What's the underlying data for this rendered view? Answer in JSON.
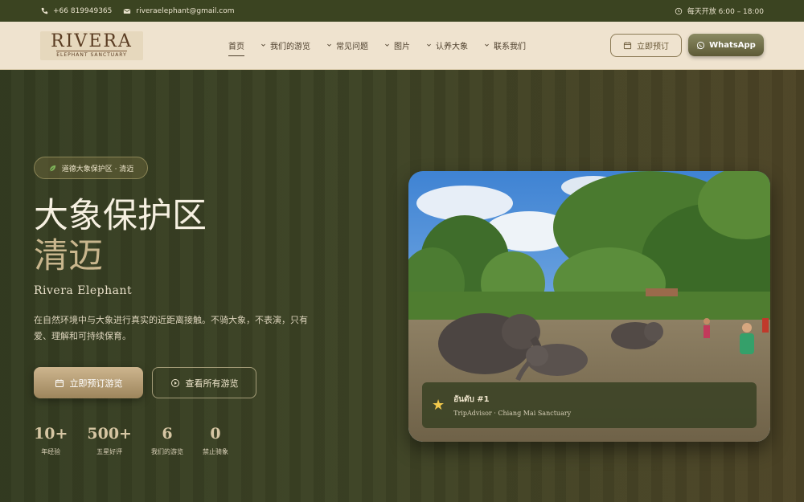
{
  "topbar": {
    "phone": "+66 819949365",
    "email": "riveraelephant@gmail.com",
    "hours": "每天开放 6:00 – 18:00"
  },
  "nav": {
    "logo_main": "RIVERA",
    "logo_sub": "ELEPHANT SANCTUARY",
    "items": [
      {
        "label": "首页",
        "active": true
      },
      {
        "label": "我们的游览"
      },
      {
        "label": "常见问题"
      },
      {
        "label": "图片"
      },
      {
        "label": "认养大象"
      },
      {
        "label": "联系我们"
      }
    ],
    "book_label": "立即预订",
    "whatsapp_label": "WhatsApp"
  },
  "hero": {
    "badge": "道德大象保护区 · 清迈",
    "title_line1": "大象保护区",
    "title_line2": "清迈",
    "subtitle": "Rivera Elephant",
    "description": "在自然环境中与大象进行真实的近距离接触。不骑大象，不表演，只有爱、理解和可持续保育。",
    "cta_primary": "立即预订游览",
    "cta_secondary": "查看所有游览",
    "stats": [
      {
        "value": "10+",
        "label": "年经验"
      },
      {
        "value": "500+",
        "label": "五星好评"
      },
      {
        "value": "6",
        "label": "我们的游览"
      },
      {
        "value": "0",
        "label": "禁止骑象"
      }
    ]
  },
  "card": {
    "rank_title": "อันดับ #1",
    "rank_sub": "TripAdvisor · Chiang Mai Sanctuary"
  },
  "colors": {
    "topbar": "#3b4421",
    "nav_bg": "#efe3cf",
    "hero_bg": "#3d4325",
    "accent_gold": "#c9b68d"
  }
}
